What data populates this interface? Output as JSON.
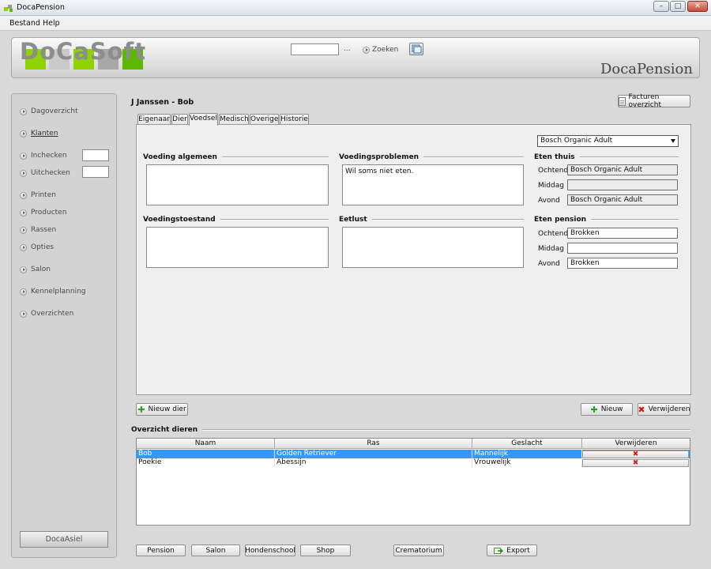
{
  "window": {
    "title": "DocaPension",
    "controls": {
      "minimize": "–",
      "maximize": "□",
      "close": "✕"
    }
  },
  "menu": [
    "Bestand",
    "Help"
  ],
  "header": {
    "logo": "DoCaSoft",
    "logo_colors": [
      "#8fd400",
      "#c9c9c9",
      "#8fd400",
      "#a8a8a8",
      "#5cb800"
    ],
    "brand": "DocaPension",
    "search": {
      "value": "",
      "dots": "...",
      "button": "Zoeken"
    }
  },
  "sidebar": {
    "items": [
      {
        "label": "Dagoverzicht"
      },
      {
        "label": "Klanten"
      },
      {
        "label": "Inchecken"
      },
      {
        "label": "Uitchecken"
      },
      {
        "label": "Printen"
      },
      {
        "label": "Producten"
      },
      {
        "label": "Rassen"
      },
      {
        "label": "Opties"
      },
      {
        "label": "Salon"
      },
      {
        "label": "Kennelplanning"
      },
      {
        "label": "Overzichten"
      }
    ],
    "footer_button": "DocaAsiel"
  },
  "main": {
    "title": "J Janssen - Bob",
    "facturen_button": "Facturen overzicht",
    "tabs": [
      "Eigenaar",
      "Dier",
      "Voedsel",
      "Medisch",
      "Overige",
      "Historie"
    ],
    "active_tab": "Voedsel",
    "food_select": "Bosch Organic Adult",
    "sections": {
      "voeding_algemeen": {
        "label": "Voeding algemeen",
        "value": ""
      },
      "voedingsproblemen": {
        "label": "Voedingsproblemen",
        "value": "Wil soms niet eten."
      },
      "voedingstoestand": {
        "label": "Voedingstoestand",
        "value": ""
      },
      "eetlust": {
        "label": "Eetlust",
        "value": ""
      }
    },
    "eten_thuis": {
      "label": "Eten thuis",
      "ochtend_label": "Ochtend",
      "ochtend": "Bosch Organic Adult",
      "middag_label": "Middag",
      "middag": "",
      "avond_label": "Avond",
      "avond": "Bosch Organic Adult"
    },
    "eten_pension": {
      "label": "Eten pension",
      "ochtend_label": "Ochtend",
      "ochtend": "Brokken",
      "middag_label": "Middag",
      "middag": "",
      "avond_label": "Avond",
      "avond": "Brokken"
    },
    "buttons": {
      "nieuw_dier": "Nieuw dier",
      "nieuw": "Nieuw",
      "verwijderen": "Verwijderen"
    }
  },
  "overview": {
    "title": "Overzicht dieren",
    "columns": [
      "Naam",
      "Ras",
      "Geslacht",
      "Verwijderen"
    ],
    "rows": [
      {
        "naam": "Bob",
        "ras": "Golden Retriever",
        "geslacht": "Mannelijk",
        "delete": "✖"
      },
      {
        "naam": "Poekie",
        "ras": "Abessijn",
        "geslacht": "Vrouwelijk",
        "delete": "✖"
      }
    ]
  },
  "bottom_buttons": [
    "Pension",
    "Salon",
    "Hondenschool",
    "Shop",
    "Crematorium",
    "Export"
  ],
  "icons": [
    "app-icon",
    "arrow-circle-icon",
    "refresh-icon",
    "document-icon",
    "plus-icon",
    "delete-x-icon",
    "export-icon",
    "dropdown-arrow-icon"
  ]
}
